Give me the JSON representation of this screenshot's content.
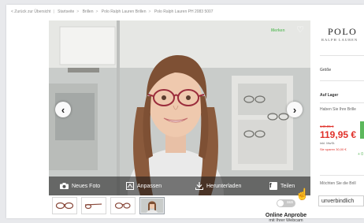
{
  "breadcrumb": [
    "< Zurück zur Übersicht",
    "Startseite",
    "Brillen",
    "Polo Ralph Lauren Brillen",
    "Polo Ralph Lauren PH 2083 5007"
  ],
  "viewer": {
    "merken_label": "Merken",
    "prev_glyph": "‹",
    "next_glyph": "›",
    "toolbar": [
      {
        "label": "Neues Foto",
        "icon": "camera-icon"
      },
      {
        "label": "Anpassen",
        "icon": "adjust-icon"
      },
      {
        "label": "Herunterladen",
        "icon": "download-icon"
      },
      {
        "label": "Teilen",
        "icon": "facebook-icon"
      }
    ]
  },
  "thumbnails": [
    "glasses-front",
    "glasses-side",
    "glasses-angle",
    "webcam-photo"
  ],
  "tryon": {
    "toggle_text": "aus",
    "title": "Online Anprobe",
    "subtitle": "mit Ihrer Webcam"
  },
  "sidebar": {
    "brand": "POLO",
    "brand_sub": "RALPH LAUREN",
    "size_label": "Größe",
    "stock_label": "Auf Lager",
    "question": "Haben Sie Ihre Brille",
    "old_price": "149,95 €",
    "price": "119,95 €",
    "vat": "inkl. MwSt.",
    "saving": "Sie sparen 30,00 €",
    "plus": "+ 0",
    "question2": "Möchten Sie die Brill",
    "select_value": "unverbindlich"
  },
  "colors": {
    "accent_green": "#5cb85c",
    "price_red": "#e0312a"
  }
}
